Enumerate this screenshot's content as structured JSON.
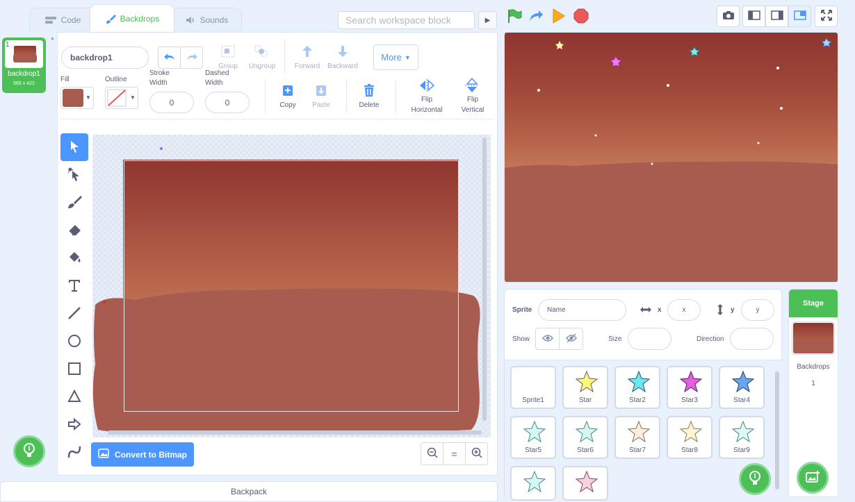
{
  "tabs": {
    "code": "Code",
    "backdrops": "Backdrops",
    "sounds": "Sounds"
  },
  "search": {
    "placeholder": "Search workspace block"
  },
  "costume": {
    "number": "1",
    "name": "backdrop1",
    "size": "565 x 422"
  },
  "paint": {
    "costume_name": "backdrop1",
    "group": "Group",
    "ungroup": "Ungroup",
    "forward": "Forward",
    "backward": "Backward",
    "more": "More",
    "fill": "Fill",
    "outline": "Outline",
    "stroke_width_label": "Stroke Width",
    "stroke_width": "0",
    "dashed_width_label": "Dashed Width",
    "dashed_width": "0",
    "copy": "Copy",
    "paste": "Paste",
    "delete": "Delete",
    "flip_h": "Flip Horizontal",
    "flip_v": "Flip Vertical",
    "convert": "Convert to Bitmap",
    "zoom_reset": "="
  },
  "colors": {
    "fill": "#a85c4f",
    "accent": "#4cbf56",
    "blue": "#4c97ff"
  },
  "backpack": "Backpack",
  "sprite_info": {
    "sprite_label": "Sprite",
    "name_placeholder": "Name",
    "x_label": "x",
    "x_placeholder": "x",
    "y_label": "y",
    "y_placeholder": "y",
    "show_label": "Show",
    "size_label": "Size",
    "direction_label": "Direction"
  },
  "sprites": [
    "Sprite1",
    "Star",
    "Star2",
    "Star3",
    "Star4",
    "Star5",
    "Star6",
    "Star7",
    "Star8",
    "Star9"
  ],
  "stage_pane": {
    "title": "Stage",
    "backdrops_label": "Backdrops",
    "backdrops_count": "1"
  }
}
